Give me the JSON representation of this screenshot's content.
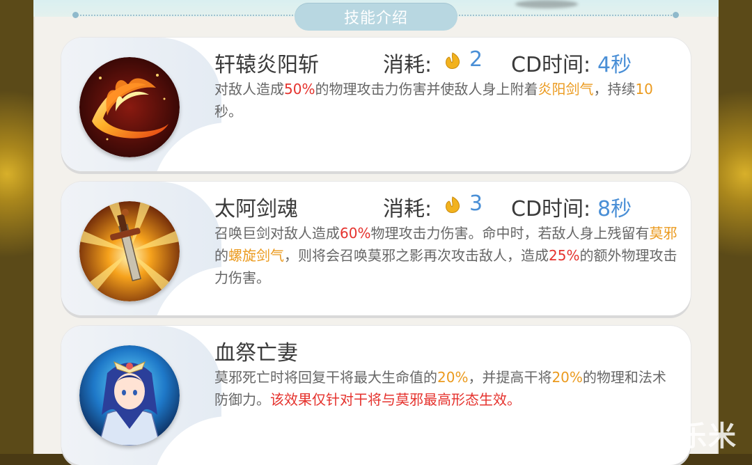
{
  "section_title": "技能介绍",
  "cost_label": "消耗:",
  "cd_label": "CD时间:",
  "skills": [
    {
      "name": "轩辕炎阳斩",
      "cost": "2",
      "cd": "4秒",
      "desc_parts": [
        "对敌人造成",
        "50%",
        "的物理攻击力伤害并使敌人身上附着",
        "炎阳剑气",
        "，持续",
        "10",
        "秒。"
      ],
      "icon": "fire-slash-icon"
    },
    {
      "name": "太阿剑魂",
      "cost": "3",
      "cd": "8秒",
      "desc_parts": [
        "召唤巨剑对敌人造成",
        "60%",
        "物理攻击力伤害。命中时，若敌人身上残留有",
        "莫邪",
        "的",
        "螺旋剑气",
        "，则将会召唤莫邪之影再次攻击敌人，造成",
        "25%",
        "的额外物理攻击力伤害。"
      ],
      "icon": "giant-sword-icon"
    },
    {
      "name": "血祭亡妻",
      "desc_parts": [
        "莫邪死亡时将回复干将最大生命值的",
        "20%",
        "，并提高干将",
        "20%",
        "的物理和法术防御力。",
        "该效果仅针对干将与莫邪最高形态生效。"
      ],
      "icon": "moye-portrait-icon"
    }
  ],
  "watermark": "乐米",
  "colors": {
    "highlight_red": "#e5322d",
    "highlight_orange": "#eb9a1e",
    "value_blue": "#4a8fd6",
    "title_pill": "#b8d7e1"
  }
}
